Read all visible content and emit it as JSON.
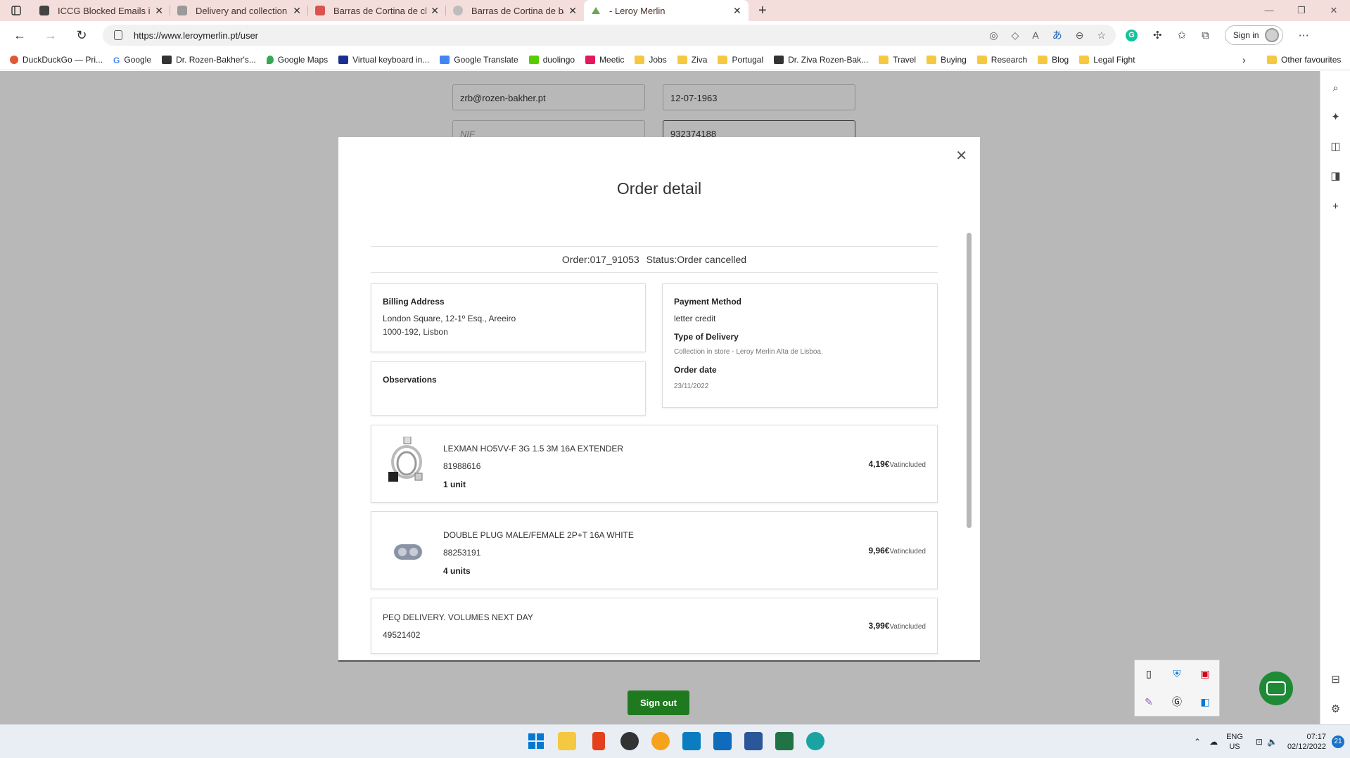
{
  "browser": {
    "tabs": [
      {
        "title": "ICCG Blocked Emails in Lisbon al",
        "favicon_color": "#444444",
        "active": false
      },
      {
        "title": "Delivery and collection - IKEA",
        "favicon_color": "#7a7a7a",
        "active": false
      },
      {
        "title": "Barras de Cortina de chuveiro W",
        "favicon_color": "#d9534f",
        "active": false
      },
      {
        "title": "Barras de Cortina de banho - Go",
        "favicon_color": "#999999",
        "active": false
      },
      {
        "title": "- Leroy Merlin",
        "favicon_color": "#6aa84f",
        "active": true
      }
    ],
    "new_tab": "+",
    "url": "https://www.leroymerlin.pt/user",
    "sign_in": "Sign in",
    "bookmarks": [
      {
        "label": "DuckDuckGo — Pri...",
        "icon": "duckduckgo-icon",
        "color": "#de5833"
      },
      {
        "label": "Google",
        "icon": "google-icon",
        "color": "#4285f4"
      },
      {
        "label": "Dr. Rozen-Bakher's...",
        "icon": "cube-icon",
        "color": "#333333"
      },
      {
        "label": "Google Maps",
        "icon": "maps-pin-icon",
        "color": "#34a853"
      },
      {
        "label": "Virtual keyboard in...",
        "icon": "keyboard-icon",
        "color": "#1c2e8f"
      },
      {
        "label": "Google Translate",
        "icon": "translate-icon",
        "color": "#4285f4"
      },
      {
        "label": "duolingo",
        "icon": "duolingo-icon",
        "color": "#58cc02"
      },
      {
        "label": "Meetic",
        "icon": "meetic-icon",
        "color": "#e4185b"
      },
      {
        "label": "Jobs",
        "icon": "folder-icon",
        "color": "#f5c842"
      },
      {
        "label": "Ziva",
        "icon": "folder-icon",
        "color": "#f5c842"
      },
      {
        "label": "Portugal",
        "icon": "folder-icon",
        "color": "#f5c842"
      },
      {
        "label": "Dr. Ziva Rozen-Bak...",
        "icon": "cube-icon",
        "color": "#333333"
      },
      {
        "label": "Travel",
        "icon": "folder-icon",
        "color": "#f5c842"
      },
      {
        "label": "Buying",
        "icon": "folder-icon",
        "color": "#f5c842"
      },
      {
        "label": "Research",
        "icon": "folder-icon",
        "color": "#f5c842"
      },
      {
        "label": "Blog",
        "icon": "folder-icon",
        "color": "#f5c842"
      },
      {
        "label": "Legal Fight",
        "icon": "folder-icon",
        "color": "#f5c842"
      }
    ],
    "other_favourites": "Other favourites"
  },
  "profile_form": {
    "email": "zrb@rozen-bakher.pt",
    "birthdate": "12-07-1963",
    "nif_placeholder": "NIF",
    "phone": "932374188"
  },
  "modal": {
    "title": "Order detail",
    "order_label": "Order:017_91053",
    "status_label": "Status:Order cancelled",
    "billing": {
      "heading": "Billing Address",
      "line1": "London Square, 12-1º Esq., Areeiro",
      "line2": "1000-192, Lisbon"
    },
    "observations": {
      "heading": "Observations"
    },
    "payment": {
      "heading": "Payment Method",
      "value": "letter credit",
      "delivery_heading": "Type of Delivery",
      "delivery_value": "Collection in store - Leroy Merlin Alta de Lisboa.",
      "date_heading": "Order date",
      "date_value": "23/11/2022"
    },
    "items": [
      {
        "name": "LEXMAN HO5VV-F 3G 1.5 3M 16A EXTENDER",
        "ref": "81988616",
        "qty": "1 unit",
        "price": "4,19€",
        "vat": "Vatincluded"
      },
      {
        "name": "DOUBLE PLUG MALE/FEMALE 2P+T 16A WHITE",
        "ref": "88253191",
        "qty": "4 units",
        "price": "9,96€",
        "vat": "Vatincluded"
      },
      {
        "name": "PEQ DELIVERY. VOLUMES NEXT DAY",
        "ref": "49521402",
        "price": "3,99€",
        "vat": "Vatincluded"
      }
    ]
  },
  "page": {
    "sign_out": "Sign out",
    "brand_green": "#1f7a1f"
  },
  "taskbar": {
    "lang_top": "ENG",
    "lang_bottom": "US",
    "time": "07:17",
    "date": "02/12/2022",
    "notifications": "21"
  }
}
